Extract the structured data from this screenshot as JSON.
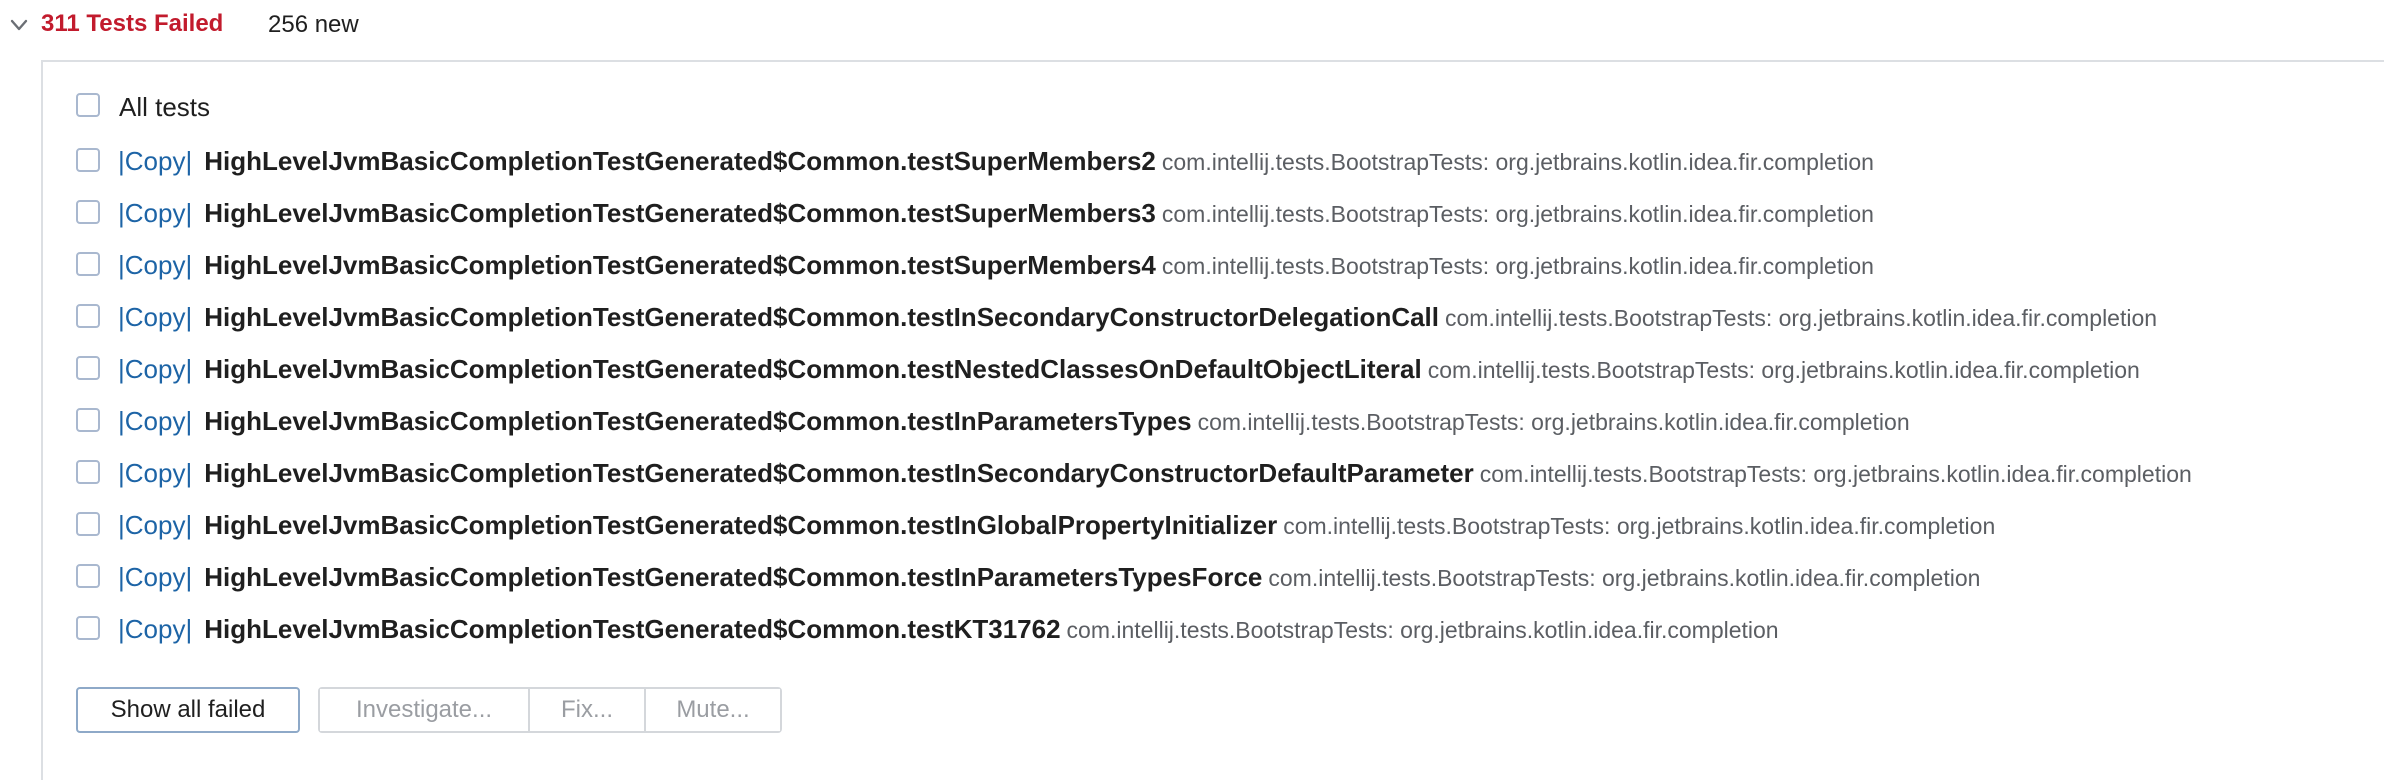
{
  "summary": {
    "failed_label": "311 Tests Failed",
    "new_label": "256 new"
  },
  "all_tests_label": "All tests",
  "copy_label": "|Copy|",
  "tests": [
    {
      "name": "HighLevelJvmBasicCompletionTestGenerated$Common.testSuperMembers2",
      "package": "com.intellij.tests.BootstrapTests: org.jetbrains.kotlin.idea.fir.completion"
    },
    {
      "name": "HighLevelJvmBasicCompletionTestGenerated$Common.testSuperMembers3",
      "package": "com.intellij.tests.BootstrapTests: org.jetbrains.kotlin.idea.fir.completion"
    },
    {
      "name": "HighLevelJvmBasicCompletionTestGenerated$Common.testSuperMembers4",
      "package": "com.intellij.tests.BootstrapTests: org.jetbrains.kotlin.idea.fir.completion"
    },
    {
      "name": "HighLevelJvmBasicCompletionTestGenerated$Common.testInSecondaryConstructorDelegationCall",
      "package": "com.intellij.tests.BootstrapTests: org.jetbrains.kotlin.idea.fir.completion"
    },
    {
      "name": "HighLevelJvmBasicCompletionTestGenerated$Common.testNestedClassesOnDefaultObjectLiteral",
      "package": "com.intellij.tests.BootstrapTests: org.jetbrains.kotlin.idea.fir.completion"
    },
    {
      "name": "HighLevelJvmBasicCompletionTestGenerated$Common.testInParametersTypes",
      "package": "com.intellij.tests.BootstrapTests: org.jetbrains.kotlin.idea.fir.completion"
    },
    {
      "name": "HighLevelJvmBasicCompletionTestGenerated$Common.testInSecondaryConstructorDefaultParameter",
      "package": "com.intellij.tests.BootstrapTests: org.jetbrains.kotlin.idea.fir.completion"
    },
    {
      "name": "HighLevelJvmBasicCompletionTestGenerated$Common.testInGlobalPropertyInitializer",
      "package": "com.intellij.tests.BootstrapTests: org.jetbrains.kotlin.idea.fir.completion"
    },
    {
      "name": "HighLevelJvmBasicCompletionTestGenerated$Common.testInParametersTypesForce",
      "package": "com.intellij.tests.BootstrapTests: org.jetbrains.kotlin.idea.fir.completion"
    },
    {
      "name": "HighLevelJvmBasicCompletionTestGenerated$Common.testKT31762",
      "package": "com.intellij.tests.BootstrapTests: org.jetbrains.kotlin.idea.fir.completion"
    }
  ],
  "actions": {
    "show_all_failed": "Show all failed",
    "investigate": "Investigate...",
    "fix": "Fix...",
    "mute": "Mute..."
  },
  "colors": {
    "failed": "#c21b2d",
    "link": "#1d64a6"
  }
}
